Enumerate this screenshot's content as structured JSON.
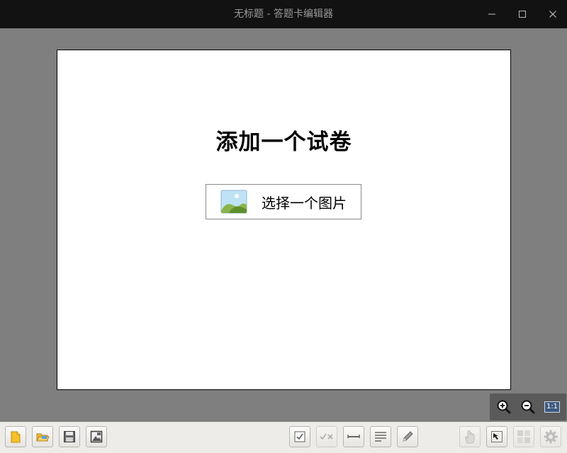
{
  "window": {
    "title": "无标题 - 答题卡编辑器",
    "minimize_icon": "minimize-icon",
    "maximize_icon": "maximize-icon",
    "close_icon": "close-icon"
  },
  "page": {
    "heading": "添加一个试卷",
    "select_image_label": "选择一个图片",
    "image_icon": "picture-icon"
  },
  "zoom": {
    "zoom_in_icon": "zoom-in-icon",
    "zoom_out_icon": "zoom-out-icon",
    "actual_size_label": "1:1"
  },
  "toolbar": {
    "left": [
      "new-file-icon",
      "open-folder-icon",
      "save-icon",
      "export-image-icon"
    ],
    "middle": [
      "checkbox-icon",
      "check-cross-icon",
      "horizontal-line-icon",
      "text-lines-icon",
      "pencil-icon"
    ],
    "right": [
      "hand-pan-icon",
      "select-arrow-icon",
      "grid-icon",
      "settings-gear-icon"
    ]
  },
  "colors": {
    "titlebar_bg": "#121212",
    "titlebar_text": "#9a9a9a",
    "workspace_bg": "#7f7f7f",
    "page_bg": "#ffffff",
    "toolbar_bg": "#eeece9",
    "zoom_panel_bg": "#5a5a5a"
  }
}
